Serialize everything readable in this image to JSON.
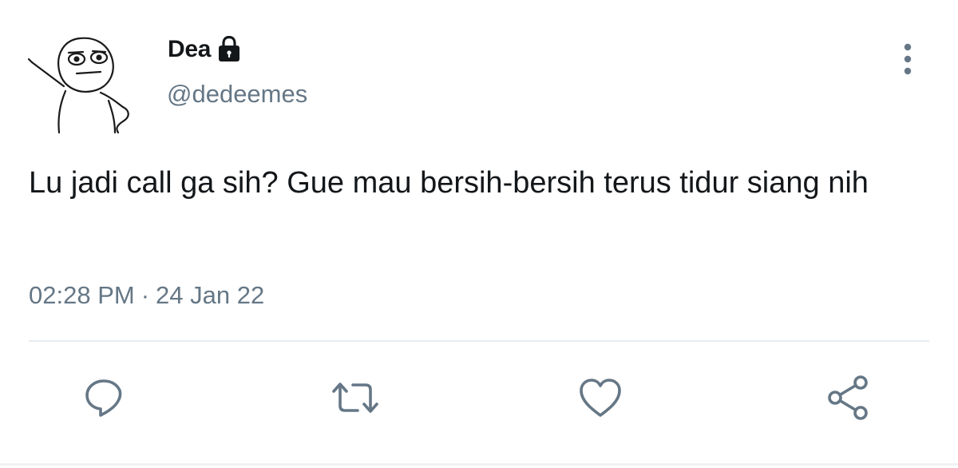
{
  "author": {
    "display_name": "Dea",
    "handle": "@dedeemes",
    "protected": true,
    "avatar": "stick-figure-avatar"
  },
  "tweet": {
    "text": "Lu jadi call ga sih? Gue mau bersih-bersih terus tidur siang nih",
    "time": "02:28 PM",
    "separator": "·",
    "date": "24 Jan 22"
  },
  "icons": {
    "lock": "lock-icon",
    "more": "more-vertical-icon",
    "reply": "reply-icon",
    "retweet": "retweet-icon",
    "like": "heart-icon",
    "share": "share-icon"
  },
  "colors": {
    "text_primary": "#14171a",
    "text_secondary": "#657786",
    "icon": "#657786",
    "divider": "#e6ecf0"
  }
}
